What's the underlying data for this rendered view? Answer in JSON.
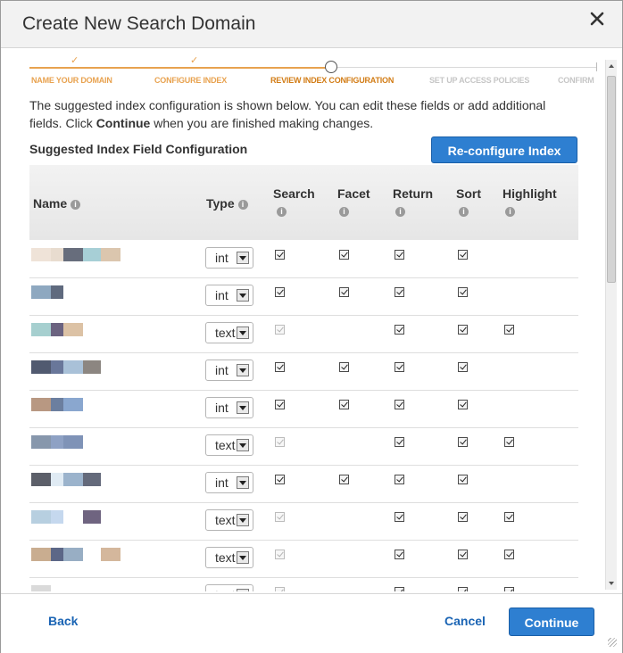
{
  "dialog": {
    "title": "Create New Search Domain",
    "close_icon": "close-icon"
  },
  "steps": [
    {
      "label": "NAME YOUR DOMAIN",
      "state": "done"
    },
    {
      "label": "CONFIGURE INDEX",
      "state": "done"
    },
    {
      "label": "REVIEW INDEX CONFIGURATION",
      "state": "current"
    },
    {
      "label": "SET UP ACCESS POLICIES",
      "state": "todo"
    },
    {
      "label": "CONFIRM",
      "state": "todo"
    }
  ],
  "intro": {
    "line1": "The suggested index configuration is shown below. You can edit these fields or add additional",
    "line2_pre": "fields. Click ",
    "line2_bold": "Continue",
    "line2_post": " when you are finished making changes."
  },
  "section_title": "Suggested Index Field Configuration",
  "reconfigure_button": "Re-configure Index",
  "table": {
    "headers": {
      "name": "Name",
      "type": "Type",
      "search": "Search",
      "facet": "Facet",
      "return": "Return",
      "sort": "Sort",
      "highlight": "Highlight"
    },
    "rows": [
      {
        "type": "int",
        "search": "on",
        "facet": true,
        "return": true,
        "sort": true,
        "highlight": false,
        "name_colors": [
          "#efe3d8",
          "#e8dccf",
          "#676d7c",
          "#a7cfd6",
          "#dbc6ae"
        ]
      },
      {
        "type": "int",
        "search": "on",
        "facet": true,
        "return": true,
        "sort": true,
        "highlight": false,
        "name_colors": [
          "#8ea8c0",
          "#5f6a7e"
        ]
      },
      {
        "type": "text",
        "search": "disabled",
        "facet": false,
        "return": true,
        "sort": true,
        "highlight": true,
        "name_colors": [
          "#a6cfcf",
          "#6b6380",
          "#dcc2a5"
        ]
      },
      {
        "type": "int",
        "search": "on",
        "facet": true,
        "return": true,
        "sort": true,
        "highlight": false,
        "name_colors": [
          "#515a70",
          "#69779a",
          "#a9c1d8",
          "#8c8681"
        ]
      },
      {
        "type": "int",
        "search": "on",
        "facet": true,
        "return": true,
        "sort": true,
        "highlight": false,
        "name_colors": [
          "#b89882",
          "#6c7f9f",
          "#8aa7cf"
        ]
      },
      {
        "type": "text",
        "search": "disabled",
        "facet": false,
        "return": true,
        "sort": true,
        "highlight": true,
        "name_colors": [
          "#8797ac",
          "#8ea1c4",
          "#7f93b7"
        ]
      },
      {
        "type": "int",
        "search": "on",
        "facet": true,
        "return": true,
        "sort": true,
        "highlight": false,
        "name_colors": [
          "#5c5f69",
          "#e0ebf4",
          "#9bb3cc",
          "#646a7b"
        ]
      },
      {
        "type": "text",
        "search": "disabled",
        "facet": false,
        "return": true,
        "sort": true,
        "highlight": true,
        "name_colors": [
          "#b7cfe0",
          "#c5d8ee",
          "#ffffff",
          "#6f6480"
        ]
      },
      {
        "type": "text",
        "search": "disabled",
        "facet": false,
        "return": true,
        "sort": true,
        "highlight": true,
        "name_colors": [
          "#c9ad90",
          "#5c6787",
          "#98aec4",
          "#ffffff",
          "#d4b79c"
        ]
      },
      {
        "type": "text",
        "search": "disabled",
        "facet": false,
        "return": true,
        "sort": true,
        "highlight": true,
        "name_colors": [
          "#dadada"
        ]
      }
    ]
  },
  "footer": {
    "back": "Back",
    "cancel": "Cancel",
    "continue": "Continue"
  }
}
